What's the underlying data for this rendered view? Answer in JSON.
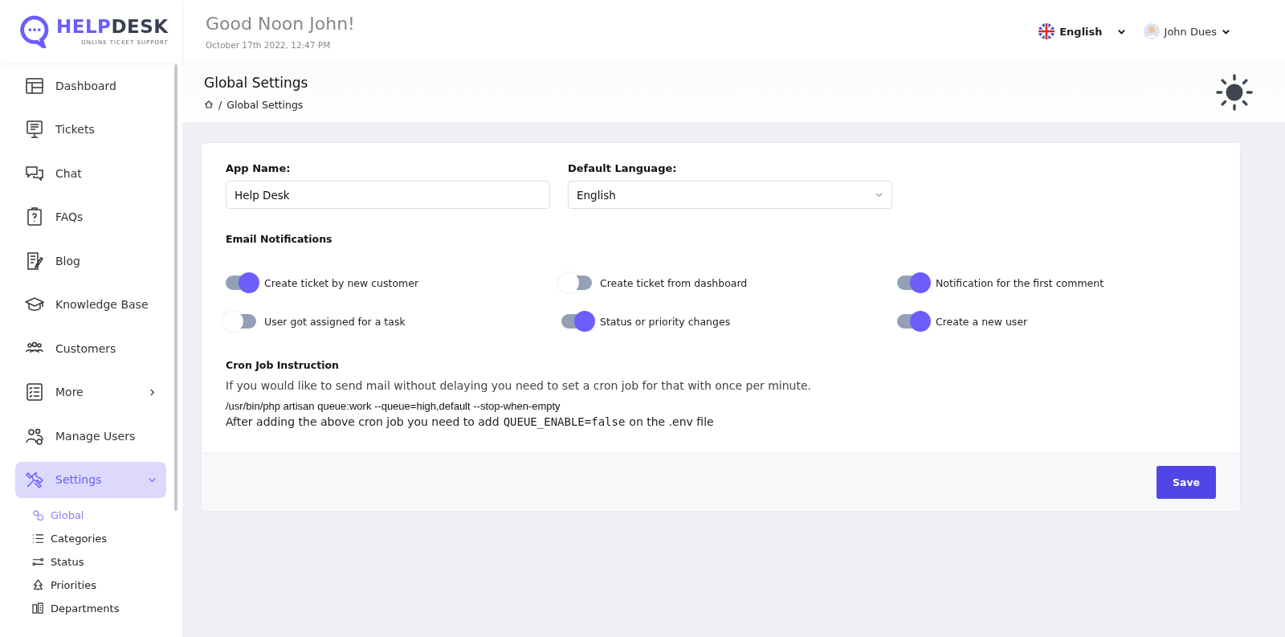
{
  "logo": {
    "primary": "HELP",
    "secondary": "DESK",
    "tagline": "ONLINE TICKET SUPPORT"
  },
  "header": {
    "greeting": "Good Noon John!",
    "datetime": "October 17th 2022, 12:47 PM",
    "language": "English",
    "user": "John Dues"
  },
  "sidebar": {
    "items": [
      {
        "label": "Dashboard",
        "kind": "link",
        "selected": false
      },
      {
        "label": "Tickets",
        "kind": "link",
        "selected": false
      },
      {
        "label": "Chat",
        "kind": "link",
        "selected": false
      },
      {
        "label": "FAQs",
        "kind": "link",
        "selected": false
      },
      {
        "label": "Blog",
        "kind": "link",
        "selected": false
      },
      {
        "label": "Knowledge Base",
        "kind": "link",
        "selected": false
      },
      {
        "label": "Customers",
        "kind": "link",
        "selected": false
      },
      {
        "label": "More",
        "kind": "group",
        "selected": false,
        "expanded": false
      },
      {
        "label": "Manage Users",
        "kind": "link",
        "selected": false
      },
      {
        "label": "Settings",
        "kind": "group",
        "selected": true,
        "expanded": true,
        "children": [
          {
            "label": "Global",
            "selected": true
          },
          {
            "label": "Categories",
            "selected": false
          },
          {
            "label": "Status",
            "selected": false
          },
          {
            "label": "Priorities",
            "selected": false
          },
          {
            "label": "Departments",
            "selected": false
          }
        ]
      }
    ]
  },
  "page": {
    "title": "Global Settings",
    "separator": "/",
    "breadcrumb": "Global Settings"
  },
  "form": {
    "app_name": {
      "label": "App Name:",
      "value": "Help Desk"
    },
    "default_language": {
      "label": "Default Language:",
      "value": "English"
    },
    "email_notifications": {
      "title": "Email Notifications",
      "toggles": [
        {
          "label": "Create ticket by new customer",
          "on": true
        },
        {
          "label": "Create ticket from dashboard",
          "on": false
        },
        {
          "label": "Notification for the first comment",
          "on": true
        },
        {
          "label": "User got assigned for a task",
          "on": false
        },
        {
          "label": "Status or priority changes",
          "on": true
        },
        {
          "label": "Create a new user",
          "on": true
        }
      ]
    },
    "cron": {
      "title": "Cron Job Instruction",
      "description": "If you would like to send mail without delaying you need to set a cron job for that with once per minute.",
      "command": "/usr/bin/php artisan queue:work --queue=high,default --stop-when-empty",
      "note_before": "After adding the above cron job you need to add",
      "note_code": "QUEUE_ENABLE=false",
      "note_after": "on the .env file"
    },
    "save_button": "Save"
  }
}
